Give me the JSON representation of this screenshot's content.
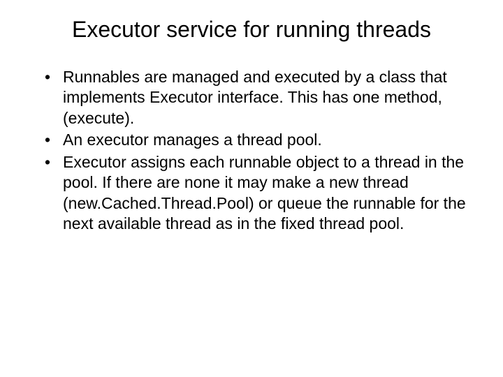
{
  "slide": {
    "title": "Executor service for running threads",
    "bullets": [
      "Runnables are managed and executed by a class that implements Executor interface.  This has one method, (execute).",
      "An executor manages a thread pool.",
      "Executor assigns each runnable object to a thread in the pool.  If there are none it may make a new thread (new.Cached.Thread.Pool) or queue the runnable for the next available thread as in the fixed thread pool."
    ]
  }
}
